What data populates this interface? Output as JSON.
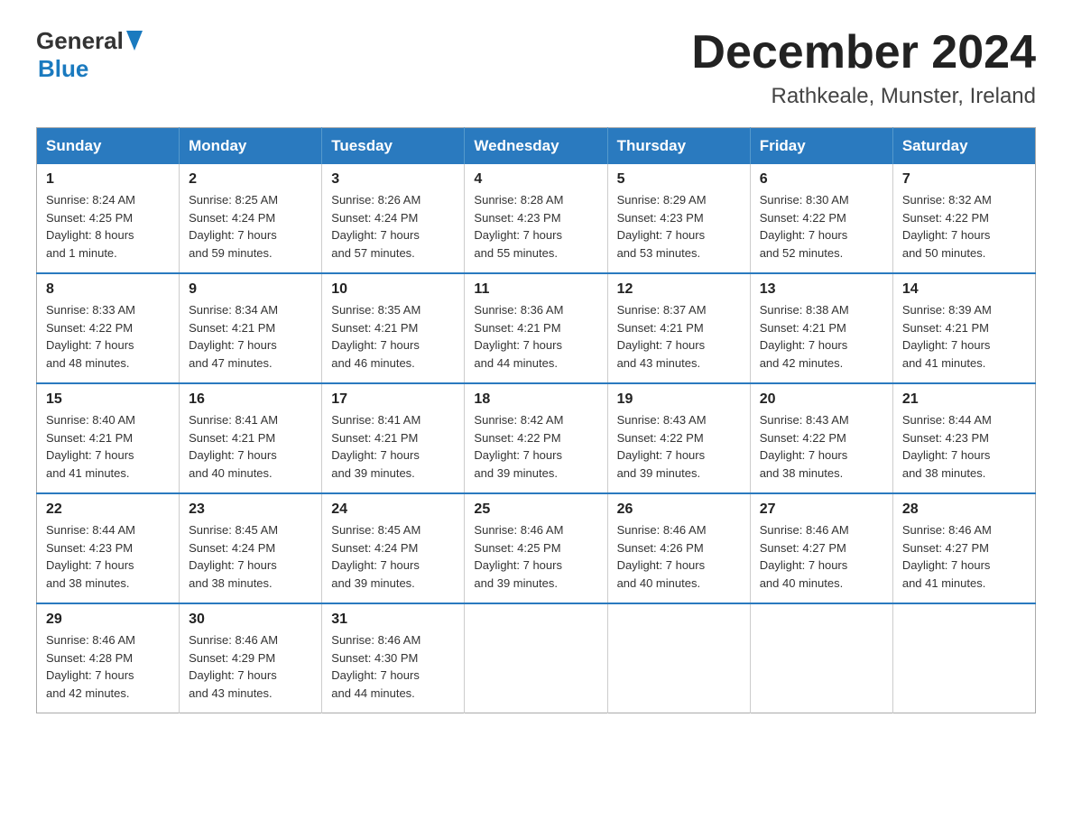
{
  "header": {
    "logo": {
      "general": "General",
      "blue": "Blue"
    },
    "title": "December 2024",
    "location": "Rathkeale, Munster, Ireland"
  },
  "weekdays": [
    "Sunday",
    "Monday",
    "Tuesday",
    "Wednesday",
    "Thursday",
    "Friday",
    "Saturday"
  ],
  "weeks": [
    [
      {
        "day": "1",
        "sunrise": "8:24 AM",
        "sunset": "4:25 PM",
        "daylight": "8 hours and 1 minute."
      },
      {
        "day": "2",
        "sunrise": "8:25 AM",
        "sunset": "4:24 PM",
        "daylight": "7 hours and 59 minutes."
      },
      {
        "day": "3",
        "sunrise": "8:26 AM",
        "sunset": "4:24 PM",
        "daylight": "7 hours and 57 minutes."
      },
      {
        "day": "4",
        "sunrise": "8:28 AM",
        "sunset": "4:23 PM",
        "daylight": "7 hours and 55 minutes."
      },
      {
        "day": "5",
        "sunrise": "8:29 AM",
        "sunset": "4:23 PM",
        "daylight": "7 hours and 53 minutes."
      },
      {
        "day": "6",
        "sunrise": "8:30 AM",
        "sunset": "4:22 PM",
        "daylight": "7 hours and 52 minutes."
      },
      {
        "day": "7",
        "sunrise": "8:32 AM",
        "sunset": "4:22 PM",
        "daylight": "7 hours and 50 minutes."
      }
    ],
    [
      {
        "day": "8",
        "sunrise": "8:33 AM",
        "sunset": "4:22 PM",
        "daylight": "7 hours and 48 minutes."
      },
      {
        "day": "9",
        "sunrise": "8:34 AM",
        "sunset": "4:21 PM",
        "daylight": "7 hours and 47 minutes."
      },
      {
        "day": "10",
        "sunrise": "8:35 AM",
        "sunset": "4:21 PM",
        "daylight": "7 hours and 46 minutes."
      },
      {
        "day": "11",
        "sunrise": "8:36 AM",
        "sunset": "4:21 PM",
        "daylight": "7 hours and 44 minutes."
      },
      {
        "day": "12",
        "sunrise": "8:37 AM",
        "sunset": "4:21 PM",
        "daylight": "7 hours and 43 minutes."
      },
      {
        "day": "13",
        "sunrise": "8:38 AM",
        "sunset": "4:21 PM",
        "daylight": "7 hours and 42 minutes."
      },
      {
        "day": "14",
        "sunrise": "8:39 AM",
        "sunset": "4:21 PM",
        "daylight": "7 hours and 41 minutes."
      }
    ],
    [
      {
        "day": "15",
        "sunrise": "8:40 AM",
        "sunset": "4:21 PM",
        "daylight": "7 hours and 41 minutes."
      },
      {
        "day": "16",
        "sunrise": "8:41 AM",
        "sunset": "4:21 PM",
        "daylight": "7 hours and 40 minutes."
      },
      {
        "day": "17",
        "sunrise": "8:41 AM",
        "sunset": "4:21 PM",
        "daylight": "7 hours and 39 minutes."
      },
      {
        "day": "18",
        "sunrise": "8:42 AM",
        "sunset": "4:22 PM",
        "daylight": "7 hours and 39 minutes."
      },
      {
        "day": "19",
        "sunrise": "8:43 AM",
        "sunset": "4:22 PM",
        "daylight": "7 hours and 39 minutes."
      },
      {
        "day": "20",
        "sunrise": "8:43 AM",
        "sunset": "4:22 PM",
        "daylight": "7 hours and 38 minutes."
      },
      {
        "day": "21",
        "sunrise": "8:44 AM",
        "sunset": "4:23 PM",
        "daylight": "7 hours and 38 minutes."
      }
    ],
    [
      {
        "day": "22",
        "sunrise": "8:44 AM",
        "sunset": "4:23 PM",
        "daylight": "7 hours and 38 minutes."
      },
      {
        "day": "23",
        "sunrise": "8:45 AM",
        "sunset": "4:24 PM",
        "daylight": "7 hours and 38 minutes."
      },
      {
        "day": "24",
        "sunrise": "8:45 AM",
        "sunset": "4:24 PM",
        "daylight": "7 hours and 39 minutes."
      },
      {
        "day": "25",
        "sunrise": "8:46 AM",
        "sunset": "4:25 PM",
        "daylight": "7 hours and 39 minutes."
      },
      {
        "day": "26",
        "sunrise": "8:46 AM",
        "sunset": "4:26 PM",
        "daylight": "7 hours and 40 minutes."
      },
      {
        "day": "27",
        "sunrise": "8:46 AM",
        "sunset": "4:27 PM",
        "daylight": "7 hours and 40 minutes."
      },
      {
        "day": "28",
        "sunrise": "8:46 AM",
        "sunset": "4:27 PM",
        "daylight": "7 hours and 41 minutes."
      }
    ],
    [
      {
        "day": "29",
        "sunrise": "8:46 AM",
        "sunset": "4:28 PM",
        "daylight": "7 hours and 42 minutes."
      },
      {
        "day": "30",
        "sunrise": "8:46 AM",
        "sunset": "4:29 PM",
        "daylight": "7 hours and 43 minutes."
      },
      {
        "day": "31",
        "sunrise": "8:46 AM",
        "sunset": "4:30 PM",
        "daylight": "7 hours and 44 minutes."
      },
      null,
      null,
      null,
      null
    ]
  ],
  "labels": {
    "sunrise": "Sunrise:",
    "sunset": "Sunset:",
    "daylight": "Daylight:"
  }
}
